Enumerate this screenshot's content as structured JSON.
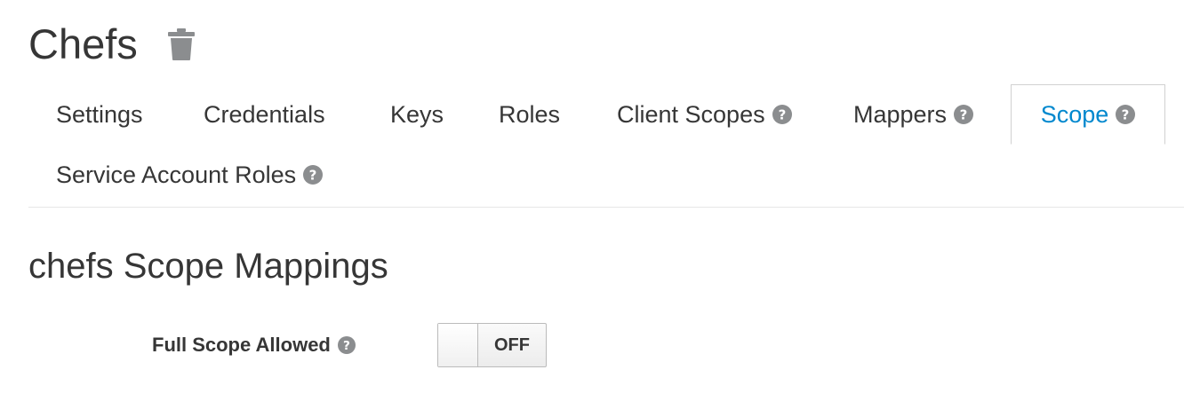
{
  "header": {
    "title": "Chefs",
    "delete_icon": "trash-icon"
  },
  "tabs": [
    {
      "label": "Settings",
      "has_help": false,
      "active": false
    },
    {
      "label": "Credentials",
      "has_help": false,
      "active": false
    },
    {
      "label": "Keys",
      "has_help": false,
      "active": false
    },
    {
      "label": "Roles",
      "has_help": false,
      "active": false
    },
    {
      "label": "Client Scopes",
      "has_help": true,
      "active": false
    },
    {
      "label": "Mappers",
      "has_help": true,
      "active": false
    },
    {
      "label": "Scope",
      "has_help": true,
      "active": true
    },
    {
      "label": "Service Account Roles",
      "has_help": true,
      "active": false
    }
  ],
  "section": {
    "title": "chefs Scope Mappings"
  },
  "form": {
    "full_scope_label": "Full Scope Allowed",
    "full_scope_value": "OFF"
  },
  "colors": {
    "text": "#363636",
    "active_tab": "#0088ce",
    "help_icon": "#8b8d8f",
    "trash_icon": "#8b8d8f",
    "divider": "#e6e6e6"
  }
}
